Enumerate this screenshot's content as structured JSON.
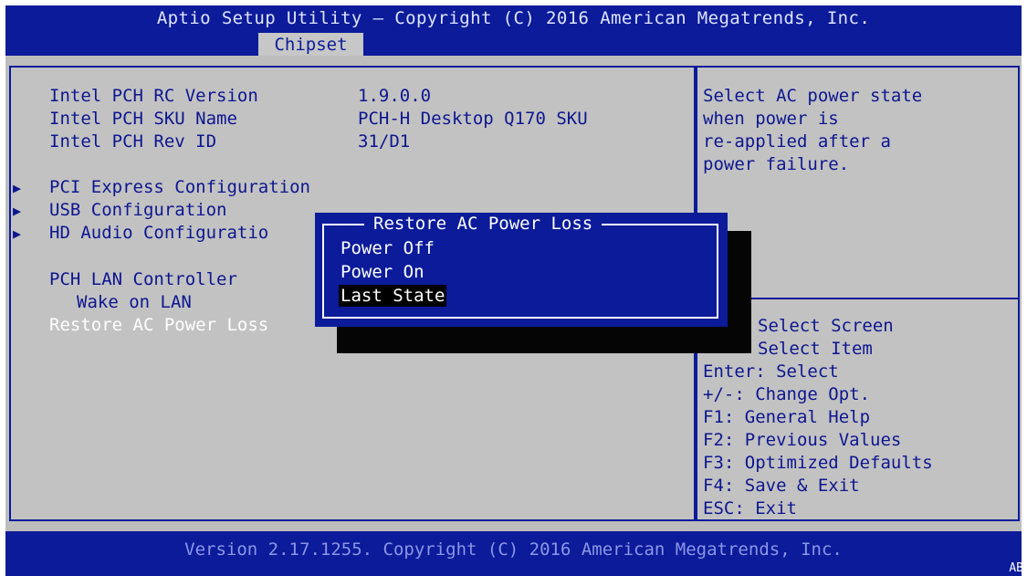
{
  "header": {
    "title": "Aptio Setup Utility – Copyright (C) 2016 American Megatrends, Inc.",
    "active_tab": "Chipset"
  },
  "info": [
    {
      "label": "Intel PCH RC Version",
      "value": "1.9.0.0"
    },
    {
      "label": "Intel PCH SKU Name",
      "value": "PCH-H Desktop Q170 SKU"
    },
    {
      "label": "Intel PCH Rev ID",
      "value": "31/D1"
    }
  ],
  "submenus": [
    {
      "label": "PCI Express Configuration"
    },
    {
      "label": "USB Configuration"
    },
    {
      "label": "HD Audio Configuratio"
    }
  ],
  "settings": {
    "pch_lan_controller": "PCH LAN Controller",
    "wake_on_lan": "Wake on LAN",
    "restore_ac_power_loss": "Restore AC Power Loss"
  },
  "help": {
    "lines": [
      "Select AC power state",
      "when power is",
      "re-applied after a",
      "power failure."
    ]
  },
  "keys": [
    "Select Screen",
    "Select Item",
    "Enter: Select",
    "+/-: Change Opt.",
    "F1: General Help",
    "F2: Previous Values",
    "F3: Optimized Defaults",
    "F4: Save & Exit",
    "ESC: Exit"
  ],
  "popup": {
    "title": "Restore AC Power Loss",
    "options": [
      "Power Off",
      "Power On",
      "Last State"
    ],
    "selected": "Last State"
  },
  "footer": {
    "version": "Version 2.17.1255. Copyright (C) 2016 American Megatrends, Inc.",
    "corner": "AB"
  },
  "colors": {
    "bios_blue": "#0b1b9a",
    "panel_gray": "#c2c2c2",
    "text_blue": "#0d1690",
    "highlight_white": "#ffffff"
  }
}
